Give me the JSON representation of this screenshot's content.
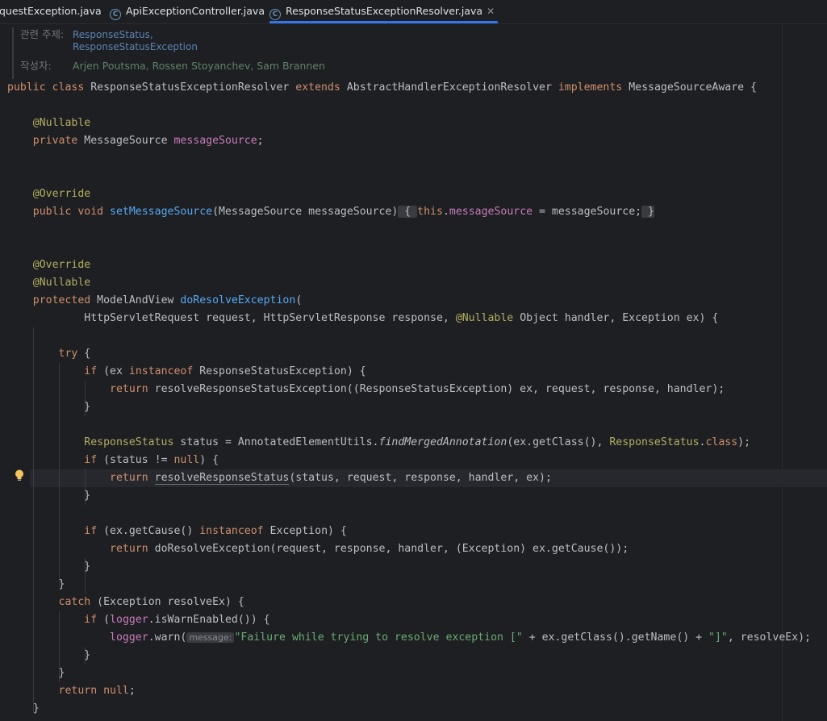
{
  "tabs": [
    {
      "label": "questException.java",
      "active": false
    },
    {
      "label": "ApiExceptionController.java",
      "active": false
    },
    {
      "label": "ResponseStatusExceptionResolver.java",
      "active": true
    }
  ],
  "doc": {
    "related_label": "관련 주제:",
    "related_items": [
      "ResponseStatus,",
      "ResponseStatusException"
    ],
    "author_label": "작성자:",
    "authors": "Arjen Poutsma, Rossen Stoyanchev, Sam Brannen"
  },
  "code": {
    "l1": {
      "a": "public class ",
      "b": "ResponseStatusExceptionResolver ",
      "c": "extends ",
      "d": "AbstractHandlerExceptionResolver ",
      "e": "implements ",
      "f": "MessageSourceAware {"
    },
    "l2": {
      "a": "@Nullable"
    },
    "l3": {
      "a": "private ",
      "b": "MessageSource ",
      "c": "messageSource",
      "d": ";"
    },
    "l4": {
      "a": "@Override"
    },
    "l5": {
      "a": "public void ",
      "b": "setMessageSource",
      "c": "(MessageSource messageSource)",
      "d": " { ",
      "e": "this",
      "f": ".",
      "g": "messageSource",
      "h": " = messageSource;",
      "i": " }"
    },
    "l6": {
      "a": "@Override"
    },
    "l7": {
      "a": "@Nullable"
    },
    "l8": {
      "a": "protected ",
      "b": "ModelAndView ",
      "c": "doResolveException",
      "d": "("
    },
    "l9": {
      "a": "HttpServletRequest request, HttpServletResponse response, ",
      "b": "@Nullable",
      "c": " Object handler, Exception ex) {"
    },
    "l10": {
      "a": "try ",
      "b": "{"
    },
    "l11": {
      "a": "if ",
      "b": "(ex ",
      "c": "instanceof ",
      "d": "ResponseStatusException) {"
    },
    "l12": {
      "a": "return ",
      "b": "resolveResponseStatusException((ResponseStatusException) ex, request, response, handler);"
    },
    "l13": {
      "a": "}"
    },
    "l14": {
      "a": "ResponseStatus ",
      "b": "status = AnnotatedElementUtils.",
      "c": "findMergedAnnotation",
      "d": "(ex.getClass(), ",
      "e": "ResponseStatus",
      ".f": "",
      "f": ".",
      "g": "class",
      "h": ");"
    },
    "l15": {
      "a": "if ",
      "b": "(status != ",
      "c": "null",
      "d": ") {"
    },
    "l16": {
      "a": "return ",
      "b": "resolveResponseStatus",
      "c": "(status, request, response, handler, ex);"
    },
    "l17": {
      "a": "}"
    },
    "l18": {
      "a": "if ",
      "b": "(ex.getCause() ",
      "c": "instanceof ",
      "d": "Exception) {"
    },
    "l19": {
      "a": "return ",
      "b": "doResolveException(request, response, handler, (Exception) ex.getCause());"
    },
    "l20": {
      "a": "}"
    },
    "l21": {
      "a": "}"
    },
    "l22": {
      "a": "catch ",
      "b": "(Exception resolveEx) {"
    },
    "l23": {
      "a": "if ",
      "b": "(",
      "c": "logger",
      ".d": "",
      "d": ".isWarnEnabled()) {"
    },
    "l24": {
      "a": "logger",
      "b": ".warn(",
      "hint": "message:",
      "c": "\"Failure while trying to resolve exception [\"",
      "d": " + ex.getClass().getName() + ",
      "e": "\"]\"",
      "f": ", resolveEx);"
    },
    "l25": {
      "a": "}"
    },
    "l26": {
      "a": "}"
    },
    "l27": {
      "a": "return ",
      "b": "null",
      ".c": "",
      "c": ";"
    },
    "l28": {
      "a": "}"
    }
  },
  "colors": {
    "background": "#1e1f22",
    "keyword": "#cf8e6d",
    "annotation": "#b3ae60",
    "method": "#56a8f5",
    "field": "#c77dbb",
    "string": "#6aab73",
    "accent": "#3574f0"
  },
  "icons": {
    "tab_class": "class-icon",
    "gutter": "lightbulb-icon",
    "close": "close-icon"
  }
}
